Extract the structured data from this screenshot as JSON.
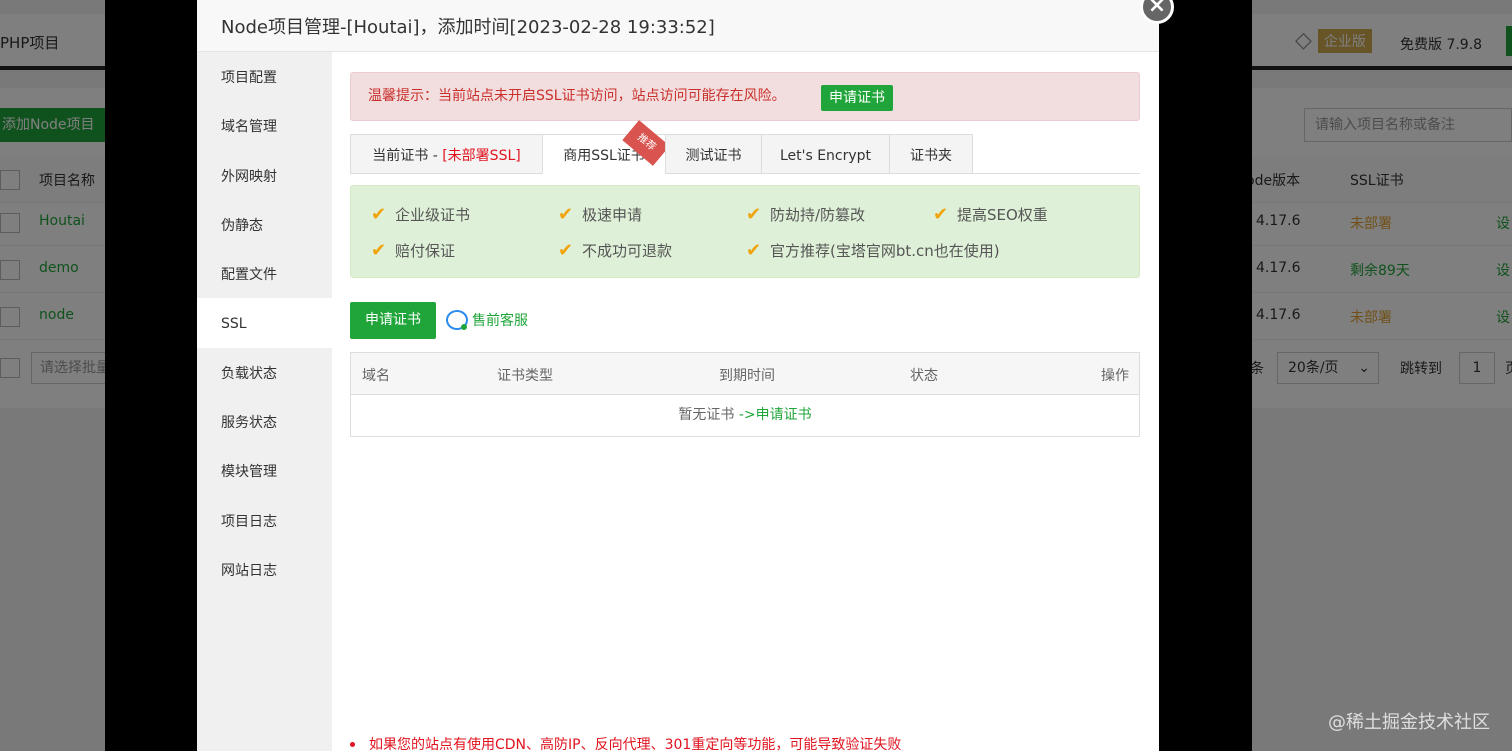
{
  "background": {
    "php_label": "PHP项目",
    "enterprise_badge": "企业版",
    "free_version": "免费版  7.9.8",
    "add_button": "添加Node项目",
    "search_placeholder": "请输入项目名称或备注",
    "columns": {
      "name": "项目名称",
      "node_version": "ode版本",
      "ssl": "SSL证书"
    },
    "rows": [
      {
        "name": "Houtai",
        "version": "4.17.6",
        "ssl": "未部署",
        "action": "设"
      },
      {
        "name": "demo",
        "version": "4.17.6",
        "ssl": "剩余89天",
        "action": "设"
      },
      {
        "name": "node",
        "version": "4.17.6",
        "ssl": "未部署",
        "action": "设"
      }
    ],
    "batch_placeholder": "请选择批量",
    "tiao": "条",
    "per_page": "20条/页",
    "jump_to": "跳转到",
    "page_input": "1",
    "ye": "页",
    "colors": {
      "green": "#20a53a",
      "orange": "#e0a030"
    }
  },
  "modal": {
    "title": "Node项目管理-[Houtai]，添加时间[2023-02-28 19:33:52]",
    "close_symbol": "×",
    "sidebar": [
      {
        "label": "项目配置"
      },
      {
        "label": "域名管理"
      },
      {
        "label": "外网映射"
      },
      {
        "label": "伪静态"
      },
      {
        "label": "配置文件"
      },
      {
        "label": "SSL"
      },
      {
        "label": "负载状态"
      },
      {
        "label": "服务状态"
      },
      {
        "label": "模块管理"
      },
      {
        "label": "项目日志"
      },
      {
        "label": "网站日志"
      }
    ],
    "active_sidebar": "SSL",
    "alert": {
      "text": "温馨提示：当前站点未开启SSL证书访问，站点访问可能存在风险。",
      "button": "申请证书"
    },
    "tabs": [
      {
        "label": "当前证书 - ",
        "extra": "[未部署SSL]"
      },
      {
        "label": "商用SSL证书",
        "extra": ""
      },
      {
        "label": "测试证书",
        "extra": ""
      },
      {
        "label": "Let's Encrypt",
        "extra": ""
      },
      {
        "label": "证书夹",
        "extra": ""
      }
    ],
    "ribbon": "推荐",
    "features": [
      "企业级证书",
      "极速申请",
      "防劫持/防篡改",
      "提高SEO权重",
      "赔付保证",
      "不成功可退款",
      "官方推荐(宝塔官网bt.cn也在使用)"
    ],
    "apply_button": "申请证书",
    "presale_link": "售前客服",
    "table": {
      "headers": [
        "域名",
        "证书类型",
        "到期时间",
        "状态",
        "操作"
      ],
      "empty_text": "暂无证书",
      "empty_link": "->申请证书"
    },
    "note": "如果您的站点有使用CDN、高防IP、反向代理、301重定向等功能，可能导致验证失败"
  },
  "watermark": "@稀土掘金技术社区"
}
